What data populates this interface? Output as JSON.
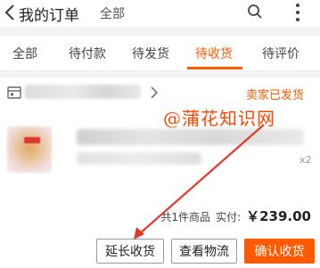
{
  "header": {
    "back_icon": "chevron-left-icon",
    "title": "我的订单",
    "filter": "全部",
    "search_icon": "search-icon",
    "more_icon": "more-vertical-icon"
  },
  "tabs": [
    {
      "label": "全部",
      "active": false
    },
    {
      "label": "待付款",
      "active": false
    },
    {
      "label": "待发货",
      "active": false
    },
    {
      "label": "待收货",
      "active": true
    },
    {
      "label": "待评价",
      "active": false
    }
  ],
  "order": {
    "shop_icon": "shop-icon",
    "status": "卖家已发货",
    "quantity": "x2",
    "summary_prefix": "共1件商品",
    "summary_paid_label": "实付:",
    "summary_amount": "￥239.00",
    "actions": {
      "extend": "延长收货",
      "logistics": "查看物流",
      "confirm": "确认收货"
    }
  },
  "watermark": "@蒲花知识网",
  "colors": {
    "accent": "#ff5a00",
    "annotation_arrow": "#e03a2a"
  }
}
